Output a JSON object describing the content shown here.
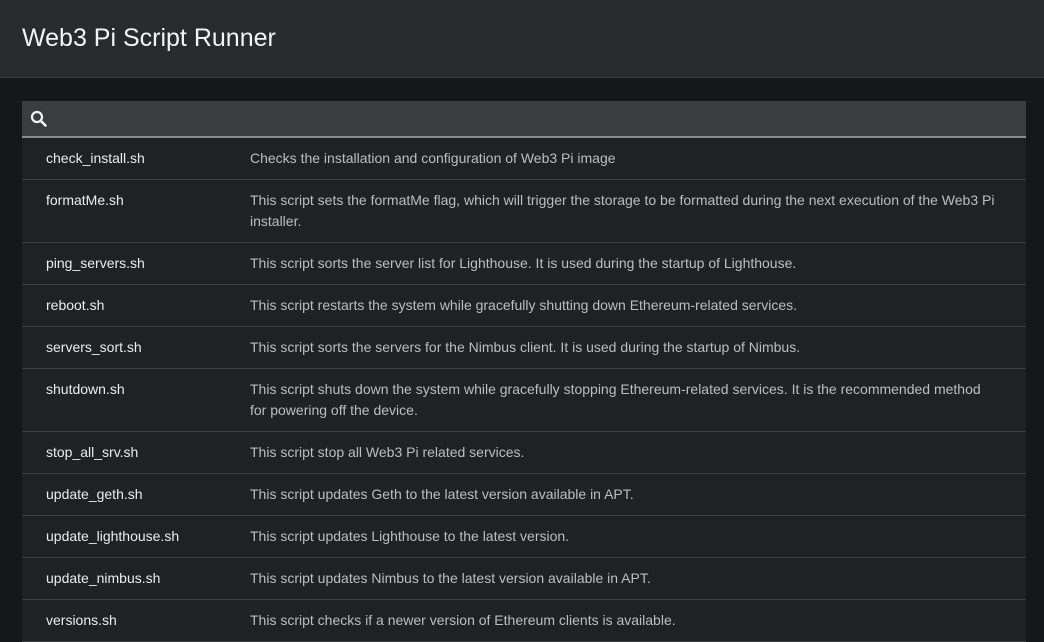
{
  "header": {
    "title": "Web3 Pi Script Runner"
  },
  "search": {
    "icon": "search-icon",
    "value": ""
  },
  "scripts": [
    {
      "name": "check_install.sh",
      "description": "Checks the installation and configuration of Web3 Pi image"
    },
    {
      "name": "formatMe.sh",
      "description": "This script sets the formatMe flag, which will trigger the storage to be formatted during the next execution of the Web3 Pi installer."
    },
    {
      "name": "ping_servers.sh",
      "description": "This script sorts the server list for Lighthouse. It is used during the startup of Lighthouse."
    },
    {
      "name": "reboot.sh",
      "description": "This script restarts the system while gracefully shutting down Ethereum-related services."
    },
    {
      "name": "servers_sort.sh",
      "description": "This script sorts the servers for the Nimbus client. It is used during the startup of Nimbus."
    },
    {
      "name": "shutdown.sh",
      "description": "This script shuts down the system while gracefully stopping Ethereum-related services. It is the recommended method for powering off the device."
    },
    {
      "name": "stop_all_srv.sh",
      "description": "This script stop all Web3 Pi related services."
    },
    {
      "name": "update_geth.sh",
      "description": "This script updates Geth to the latest version available in APT."
    },
    {
      "name": "update_lighthouse.sh",
      "description": "This script updates Lighthouse to the latest version."
    },
    {
      "name": "update_nimbus.sh",
      "description": "This script updates Nimbus to the latest version available in APT."
    },
    {
      "name": "versions.sh",
      "description": "This script checks if a newer version of Ethereum clients is available."
    }
  ],
  "colors": {
    "header_bg": "#292a2e",
    "page_bg": "#16171b",
    "row_bg": "#202125",
    "search_bg": "#3b3c40"
  }
}
